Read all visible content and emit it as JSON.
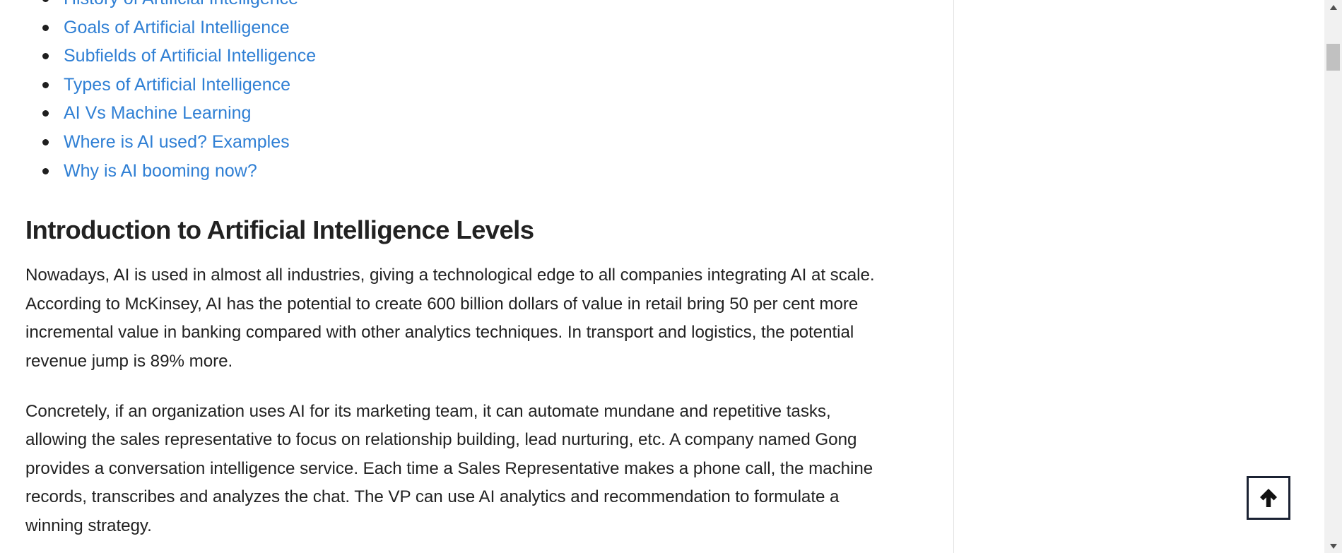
{
  "toc": {
    "items": [
      {
        "label": "History of Artificial Intelligence"
      },
      {
        "label": "Goals of Artificial Intelligence"
      },
      {
        "label": "Subfields of Artificial Intelligence"
      },
      {
        "label": "Types of Artificial Intelligence"
      },
      {
        "label": "AI Vs Machine Learning"
      },
      {
        "label": "Where is AI used? Examples"
      },
      {
        "label": "Why is AI booming now?"
      }
    ]
  },
  "article": {
    "heading": "Introduction to Artificial Intelligence Levels",
    "paragraph_1": "Nowadays, AI is used in almost all industries, giving a technological edge to all companies integrating AI at scale. According to McKinsey, AI has the potential to create 600 billion dollars of value in retail bring 50 per cent more incremental value in banking compared with other analytics techniques. In transport and logistics, the potential revenue jump is 89% more.",
    "paragraph_2": "Concretely, if an organization uses AI for its marketing team, it can automate mundane and repetitive tasks, allowing the sales representative to focus on relationship building, lead nurturing, etc. A company named Gong provides a conversation intelligence service. Each time a Sales Representative makes a phone call, the machine records, transcribes and analyzes the chat. The VP can use AI analytics and recommendation to formulate a winning strategy."
  },
  "back_to_top": {
    "icon": "arrow-up-icon"
  },
  "colors": {
    "link": "#2f7fd4",
    "text": "#222222",
    "button_border": "#1b2233"
  }
}
